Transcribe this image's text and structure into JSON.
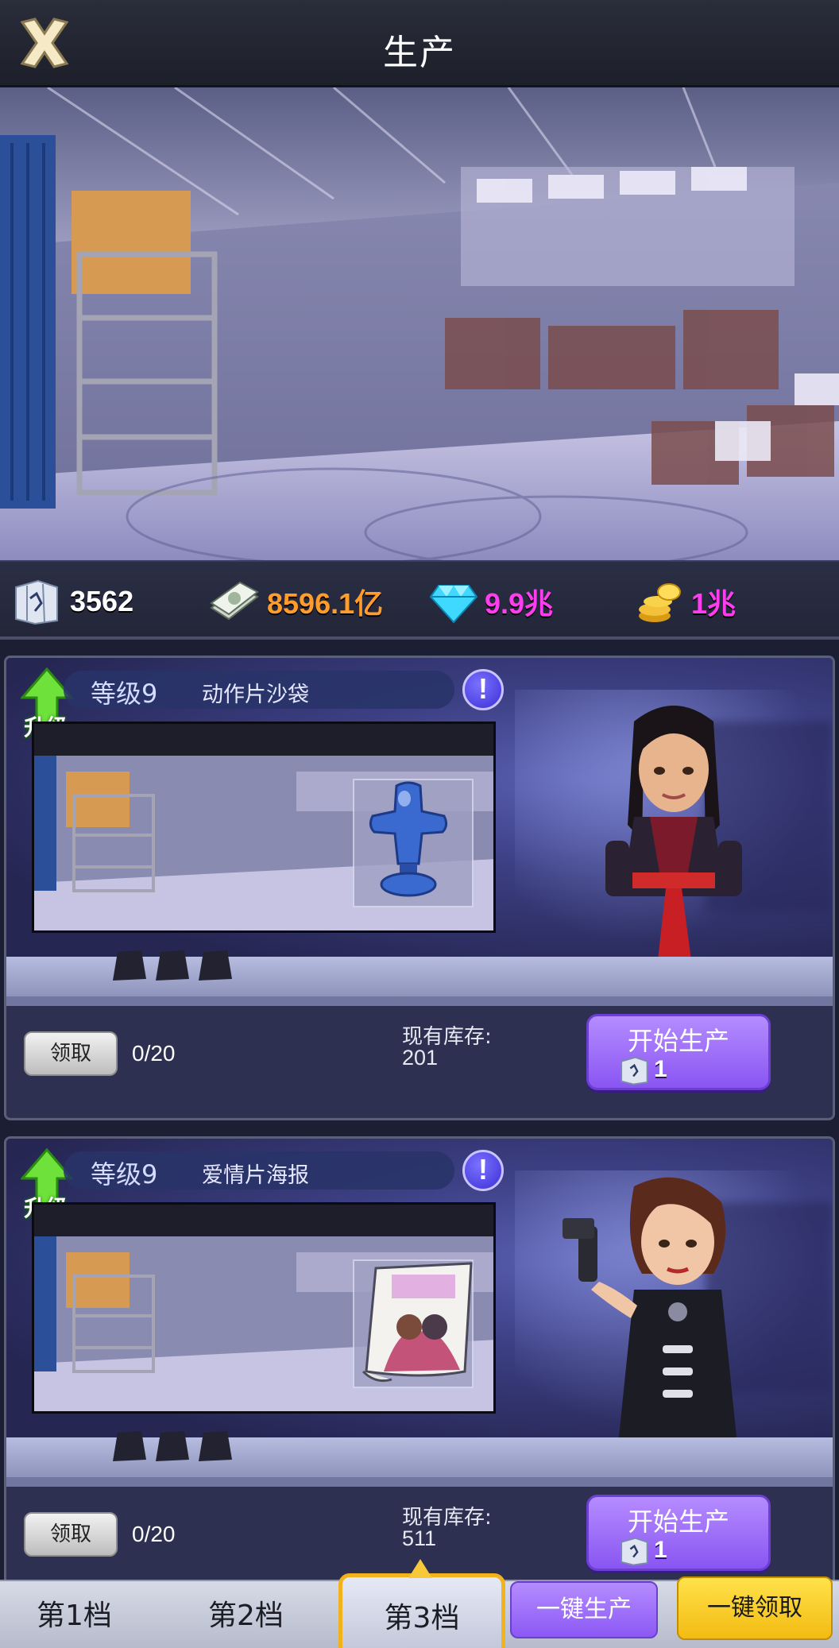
{
  "header": {
    "title": "生产"
  },
  "resources": [
    {
      "icon": "blueprint-icon",
      "value": "3562",
      "color": "#ffffff"
    },
    {
      "icon": "cash-icon",
      "value": "8596.1亿",
      "color": "#ff9c2b"
    },
    {
      "icon": "diamond-icon",
      "value": "9.9兆",
      "color": "#ff3df0"
    },
    {
      "icon": "gold-coins-icon",
      "value": "1兆",
      "color": "#ff3df0"
    }
  ],
  "cards": [
    {
      "upgrade_label": "升级",
      "level": "等级9",
      "name": "动作片沙袋",
      "product_icon": "punching-bag-icon",
      "character_icon": "female-fighter-character",
      "claim_label": "领取",
      "progress": "0/20",
      "stock_label": "现有库存:",
      "stock_value": "201",
      "start_label": "开始生产",
      "start_cost": "1"
    },
    {
      "upgrade_label": "升级",
      "level": "等级9",
      "name": "爱情片海报",
      "product_icon": "love-poster-icon",
      "character_icon": "female-agent-character",
      "claim_label": "领取",
      "progress": "0/20",
      "stock_label": "现有库存:",
      "stock_value": "511",
      "start_label": "开始生产",
      "start_cost": "1"
    }
  ],
  "tabs": {
    "tab1": "第1档",
    "tab2": "第2档",
    "tab3": "第3档",
    "active": "tab3",
    "onekey_produce": "一键生产",
    "onekey_claim": "一键领取"
  }
}
